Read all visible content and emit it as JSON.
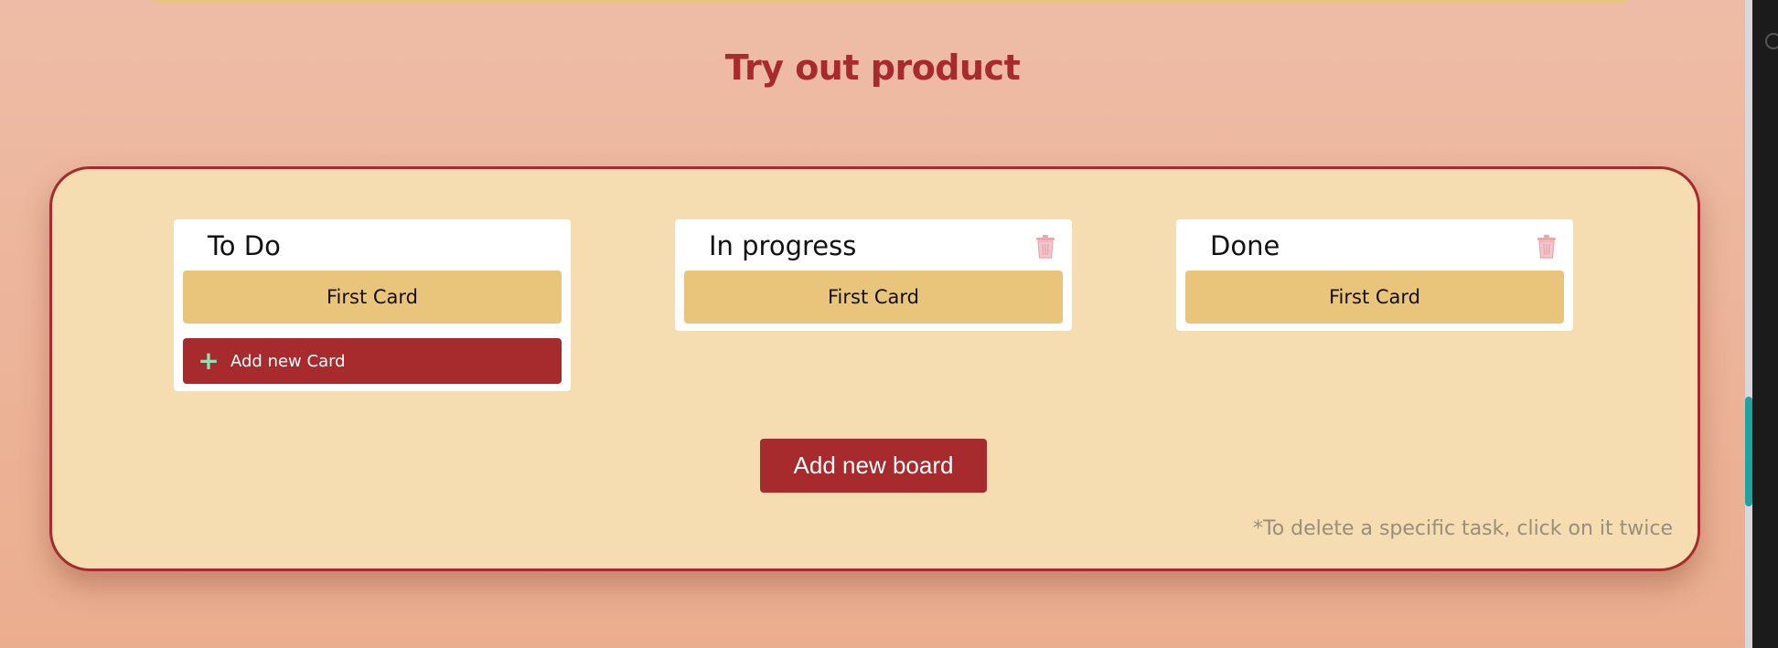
{
  "page": {
    "title": "Try out product"
  },
  "boards": [
    {
      "title": "To Do",
      "cards": [
        "First Card"
      ],
      "has_delete": false,
      "add_card_label": "Add new Card"
    },
    {
      "title": "In progress",
      "cards": [
        "First Card"
      ],
      "has_delete": true
    },
    {
      "title": "Done",
      "cards": [
        "First Card"
      ],
      "has_delete": true
    }
  ],
  "actions": {
    "add_board_label": "Add new board"
  },
  "note": "*To delete a specific task, click on it twice",
  "icons": {
    "delete": "trash-icon",
    "add": "plus-icon"
  },
  "colors": {
    "accent": "#a72a2c",
    "card": "#e9c57b",
    "panel": "#f5ddb1",
    "plus": "#8fe0b2",
    "trash": "#e8a6ae"
  }
}
